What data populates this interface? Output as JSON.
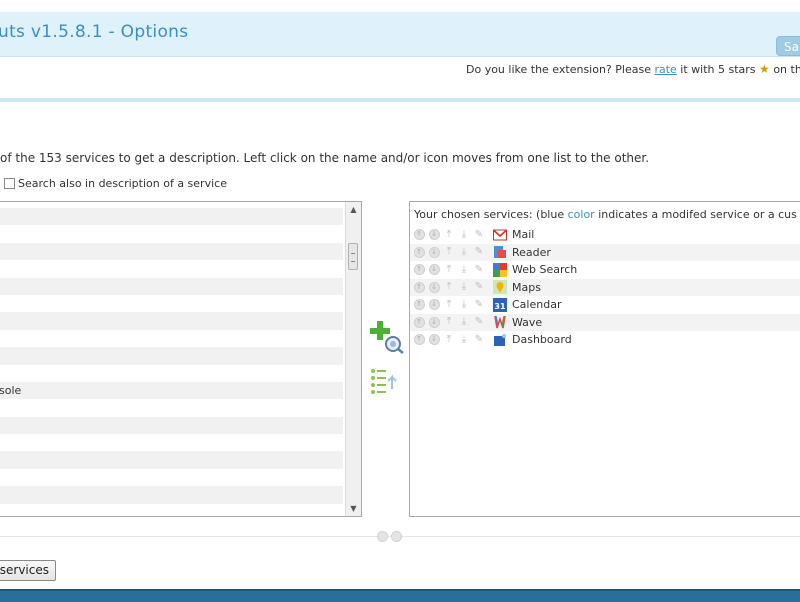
{
  "header": {
    "title": "uts v1.5.8.1 - Options",
    "save_label": "Sa"
  },
  "rate": {
    "prefix": "Do you like the extension? Please ",
    "link": "rate",
    "suffix": " it with 5 stars ",
    "tail": "on th"
  },
  "instructions": "of the 153 services to get a description. Left click on the name and/or icon moves from one list to the other.",
  "search_description_label": "Search also in description of a service",
  "available_list": {
    "rows": [
      "",
      "",
      "",
      "",
      "",
      "",
      "",
      "",
      "",
      "",
      "sole",
      "",
      "",
      "",
      "",
      "",
      "",
      ""
    ]
  },
  "chosen_list": {
    "header_prefix": "Your chosen services: (blue ",
    "header_blue": "color",
    "header_suffix": " indicates a modifed service or a cus",
    "services": [
      {
        "label": "Mail",
        "icon": "gmail-icon"
      },
      {
        "label": "Reader",
        "icon": "reader-icon"
      },
      {
        "label": "Web Search",
        "icon": "web-search-icon"
      },
      {
        "label": "Maps",
        "icon": "maps-icon"
      },
      {
        "label": "Calendar",
        "icon": "calendar-icon",
        "icon_text": "31"
      },
      {
        "label": "Wave",
        "icon": "wave-icon"
      },
      {
        "label": "Dashboard",
        "icon": "dashboard-icon"
      }
    ]
  },
  "footer": {
    "services_button_label": "services"
  },
  "colors": {
    "accent": "#3a8fc6",
    "header_bg": "#dff1fb",
    "bottom_bar": "#2a6f9c"
  }
}
